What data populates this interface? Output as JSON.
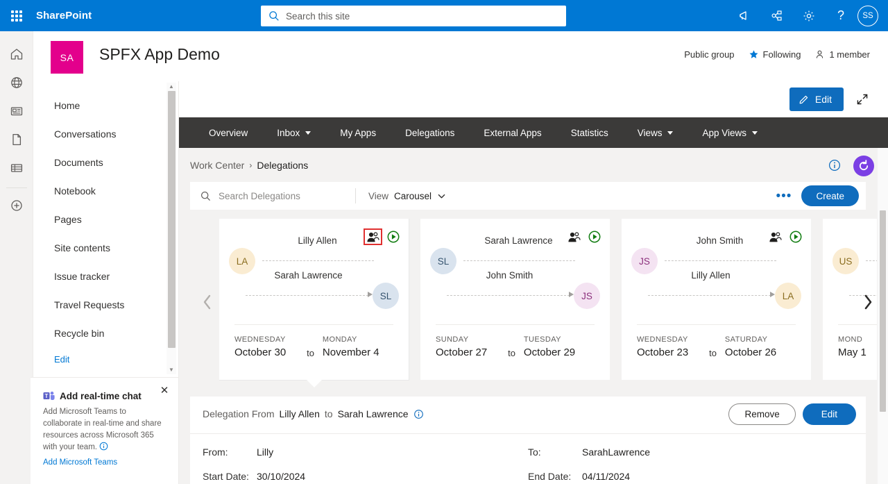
{
  "suite": {
    "brand": "SharePoint",
    "search_placeholder": "Search this site",
    "actions": [
      {
        "name": "megaphone-icon",
        "label": "Megaphone"
      },
      {
        "name": "org-chart-icon",
        "label": "Org chart"
      },
      {
        "name": "gear-icon",
        "label": "Settings"
      },
      {
        "name": "help-icon",
        "label": "Help"
      }
    ],
    "avatar_initials": "SS",
    "bg_color": "#0078d4"
  },
  "rail": {
    "items": [
      {
        "name": "home-icon",
        "label": "Home"
      },
      {
        "name": "globe-icon",
        "label": "Sites"
      },
      {
        "name": "news-icon",
        "label": "News"
      },
      {
        "name": "document-icon",
        "label": "Files"
      },
      {
        "name": "lists-icon",
        "label": "Lists"
      },
      {
        "name": "plus-icon",
        "label": "Create"
      }
    ]
  },
  "site": {
    "logo_initials": "SA",
    "logo_color": "#e3008c",
    "title": "SPFX App Demo",
    "privacy": "Public group",
    "following": "Following",
    "members": "1 member"
  },
  "commandbar": {
    "edit_label": "Edit",
    "expand_label": "Expand"
  },
  "sidebar": {
    "items": [
      {
        "label": "Home"
      },
      {
        "label": "Conversations"
      },
      {
        "label": "Documents"
      },
      {
        "label": "Notebook"
      },
      {
        "label": "Pages"
      },
      {
        "label": "Site contents"
      },
      {
        "label": "Issue tracker"
      },
      {
        "label": "Travel Requests"
      },
      {
        "label": "Recycle bin"
      }
    ],
    "edit_link": "Edit"
  },
  "promo": {
    "title": "Add real-time chat",
    "body": "Add Microsoft Teams to collaborate in real-time and share resources across Microsoft 365 with your team.",
    "link": "Add Microsoft Teams"
  },
  "webpart_nav": {
    "tabs": [
      {
        "label": "Overview",
        "has_caret": false
      },
      {
        "label": "Inbox",
        "has_caret": true
      },
      {
        "label": "My Apps",
        "has_caret": false
      },
      {
        "label": "Delegations",
        "has_caret": false
      },
      {
        "label": "External Apps",
        "has_caret": false
      },
      {
        "label": "Statistics",
        "has_caret": false
      },
      {
        "label": "Views",
        "has_caret": true
      },
      {
        "label": "App Views",
        "has_caret": true
      }
    ],
    "bg_color": "#3b3a39"
  },
  "breadcrumb": {
    "root": "Work Center",
    "separator": "›",
    "current": "Delegations"
  },
  "toolbar": {
    "search_placeholder": "Search Delegations",
    "view_label": "View",
    "view_value": "Carousel",
    "more_label": "•••",
    "create_label": "Create"
  },
  "carousel": {
    "prev_label": "Previous",
    "next_label": "Next",
    "cards": [
      {
        "from_name": "Lilly Allen",
        "from_initials": "LA",
        "from_av_bg": "#faecd2",
        "from_av_fg": "#8a6d1f",
        "to_name": "Sarah Lawrence",
        "to_initials": "SL",
        "to_av_bg": "#d9e3ee",
        "to_av_fg": "#35536e",
        "start_day": "WEDNESDAY",
        "start_date": "October 30",
        "to_word": "to",
        "end_day": "MONDAY",
        "end_date": "November 4",
        "selected": true,
        "highlighted_icon": true
      },
      {
        "from_name": "Sarah Lawrence",
        "from_initials": "SL",
        "from_av_bg": "#d9e3ee",
        "from_av_fg": "#35536e",
        "to_name": "John Smith",
        "to_initials": "JS",
        "to_av_bg": "#f4e3f2",
        "to_av_fg": "#8b2f7c",
        "start_day": "SUNDAY",
        "start_date": "October 27",
        "to_word": "to",
        "end_day": "TUESDAY",
        "end_date": "October 29",
        "selected": false,
        "highlighted_icon": false
      },
      {
        "from_name": "John Smith",
        "from_initials": "JS",
        "from_av_bg": "#f4e3f2",
        "from_av_fg": "#8b2f7c",
        "to_name": "Lilly Allen",
        "to_initials": "LA",
        "to_av_bg": "#faecd2",
        "to_av_fg": "#8a6d1f",
        "start_day": "WEDNESDAY",
        "start_date": "October 23",
        "to_word": "to",
        "end_day": "SATURDAY",
        "end_date": "October 26",
        "selected": false,
        "highlighted_icon": false
      },
      {
        "from_name": "",
        "from_initials": "US",
        "from_av_bg": "#faecd2",
        "from_av_fg": "#8a6d1f",
        "to_name": "",
        "to_initials": "",
        "to_av_bg": "transparent",
        "to_av_fg": "transparent",
        "start_day": "MOND",
        "start_date": "May 1",
        "to_word": "",
        "end_day": "",
        "end_date": "",
        "selected": false,
        "highlighted_icon": false
      }
    ]
  },
  "detail": {
    "title_prefix": "Delegation From",
    "title_from": "Lilly Allen",
    "title_mid": "to",
    "title_to": "Sarah Lawrence",
    "remove_label": "Remove",
    "edit_label": "Edit",
    "from_label": "From:",
    "from_value": "Lilly",
    "to_label": "To:",
    "to_value": "SarahLawrence",
    "start_label": "Start Date:",
    "start_value": "30/10/2024",
    "end_label": "End Date:",
    "end_value": "04/11/2024"
  },
  "colors": {
    "accent": "#0078d4",
    "primary_button": "#0f6cbd",
    "nav_dark": "#3b3a39",
    "canvas": "#f3f2f1",
    "refresh_purple": "#7b3fe4",
    "highlight_red": "#e03030",
    "play_green": "#107c10"
  }
}
